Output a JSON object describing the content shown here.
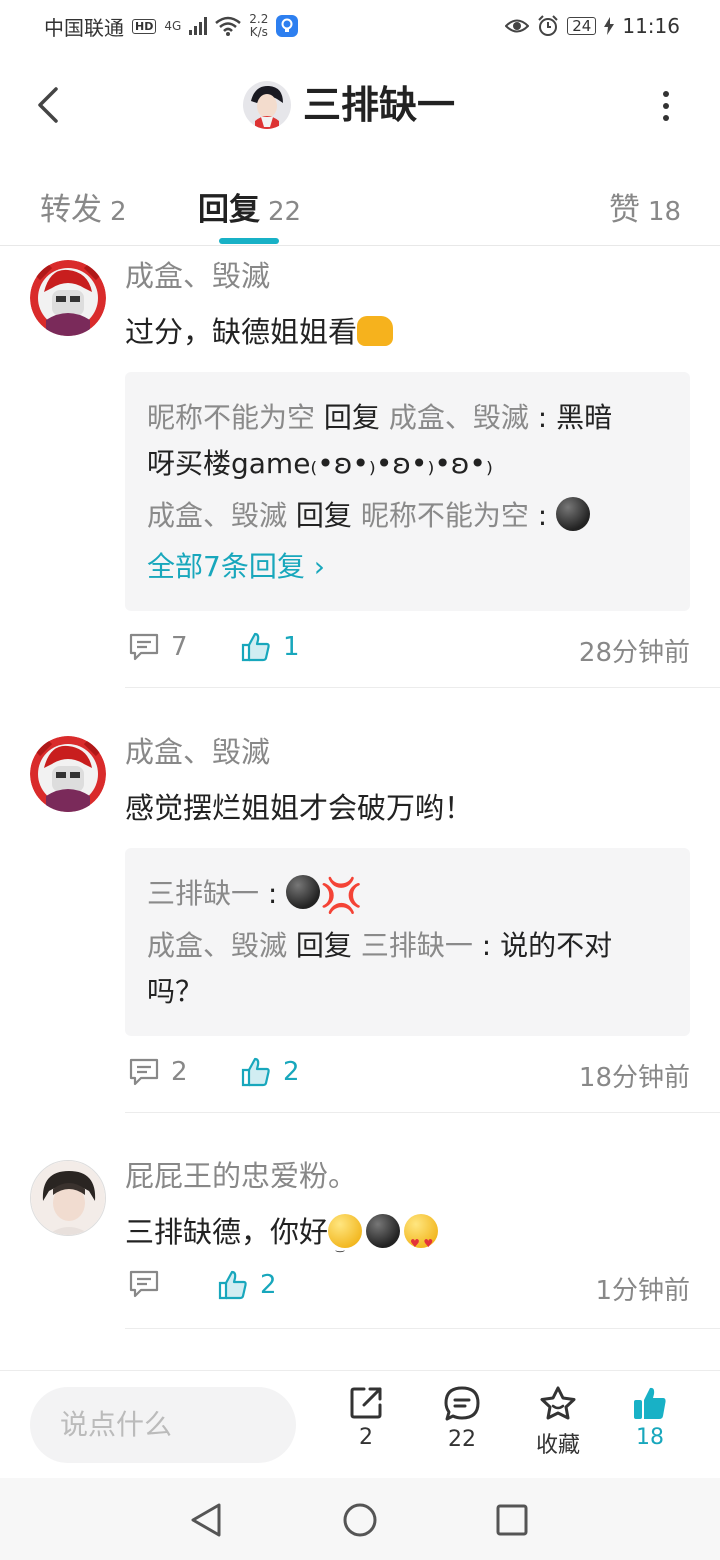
{
  "status_bar": {
    "carrier": "中国联通",
    "hd": "HD",
    "network": "4G",
    "speed_value": "2.2",
    "speed_unit": "K/s",
    "battery": "24",
    "time": "11:16"
  },
  "header": {
    "title": "三排缺一"
  },
  "tabs": [
    {
      "label": "转发",
      "count": "2"
    },
    {
      "label": "回复",
      "count": "22"
    },
    {
      "label": "赞",
      "count": "18"
    }
  ],
  "comments": [
    {
      "name": "成盒、毁滅",
      "text": "过分，缺德姐姐看",
      "replies": [
        {
          "nick": "昵称不能为空",
          "reply_word": "回复",
          "target": "成盒、毁滅",
          "sep": " : ",
          "text_line1": "黑暗",
          "text_line2": "呀买楼game₍•ʚ•₎•ʚ•₎•ʚ•₎"
        },
        {
          "nick": "成盒、毁滅",
          "reply_word": "回复",
          "target": "昵称不能为空",
          "sep": " : "
        }
      ],
      "more_replies": "全部7条回复 ›",
      "comment_count": "7",
      "like_count": "1",
      "time": "28分钟前"
    },
    {
      "name": "成盒、毁滅",
      "text": "感觉摆烂姐姐才会破万哟！",
      "replies": [
        {
          "nick": "三排缺一",
          "sep": " : "
        },
        {
          "nick": "成盒、毁滅",
          "reply_word": "回复",
          "target": "三排缺一",
          "sep": " : ",
          "text_line1": "说的不对",
          "text_line2": "吗？"
        }
      ],
      "comment_count": "2",
      "like_count": "2",
      "time": "18分钟前"
    },
    {
      "name": "屁屁王的忠爱粉。",
      "text": "三排缺德，你好",
      "like_count": "2",
      "time": "1分钟前"
    }
  ],
  "bottom_bar": {
    "input_placeholder": "说点什么",
    "share_count": "2",
    "comment_count": "22",
    "favorite_label": "收藏",
    "like_count": "18"
  },
  "colors": {
    "accent": "#18b1c6",
    "text_primary": "#222222",
    "text_secondary": "#888888",
    "reply_bg": "#f5f5f6"
  }
}
